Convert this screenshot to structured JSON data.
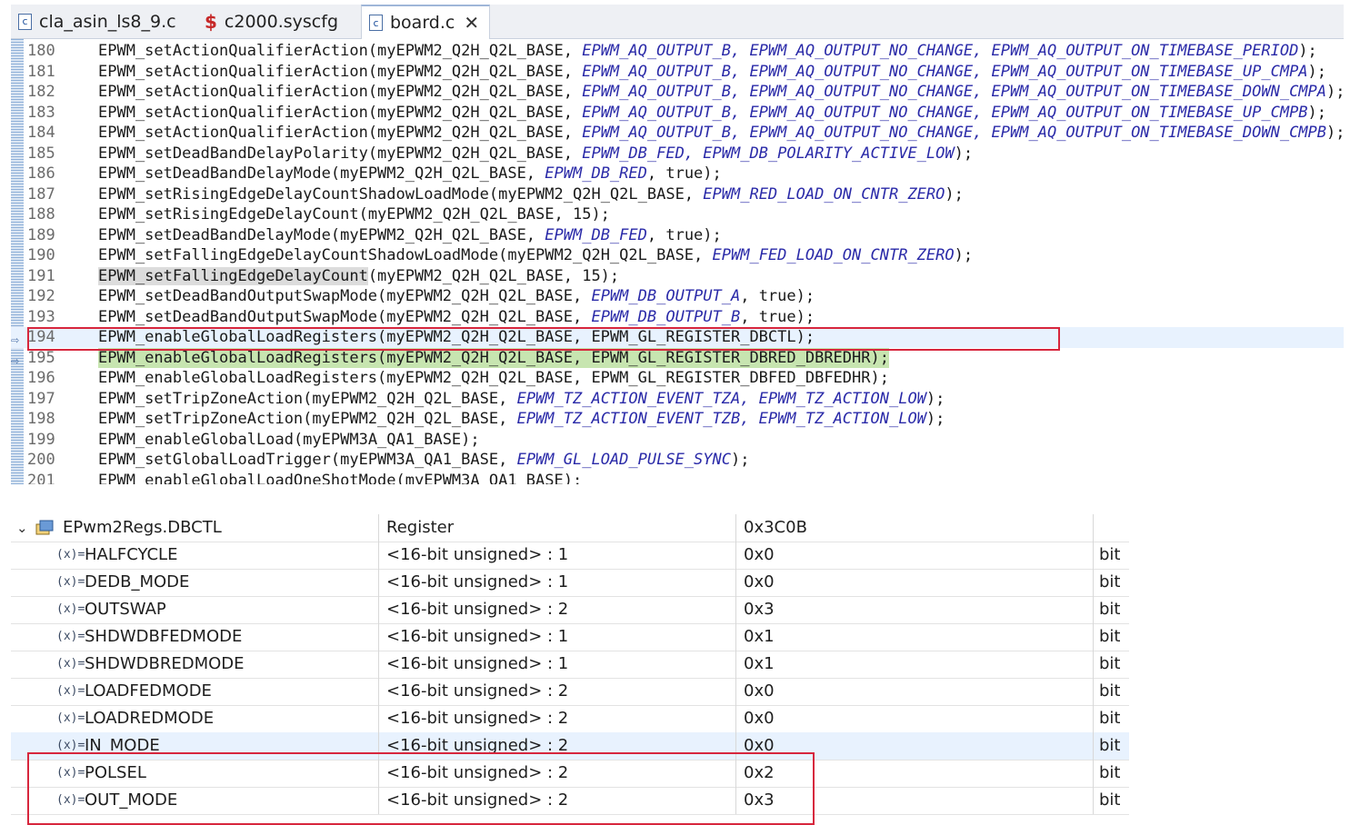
{
  "tabs": [
    {
      "label": "cla_asin_ls8_9.c",
      "icon": "c-file-icon"
    },
    {
      "label": "c2000.syscfg",
      "icon": "syscfg-icon"
    },
    {
      "label": "board.c",
      "icon": "c-file-icon",
      "active": true
    }
  ],
  "editor": {
    "lines": [
      {
        "num": "180",
        "fn": "EPWM_setActionQualifierAction",
        "args": "(myEPWM2_Q2H_Q2L_BASE, ",
        "consts": "EPWM_AQ_OUTPUT_B, EPWM_AQ_OUTPUT_NO_CHANGE, EPWM_AQ_OUTPUT_ON_TIMEBASE_PERIOD",
        "tail": ");"
      },
      {
        "num": "181",
        "fn": "EPWM_setActionQualifierAction",
        "args": "(myEPWM2_Q2H_Q2L_BASE, ",
        "consts": "EPWM_AQ_OUTPUT_B, EPWM_AQ_OUTPUT_NO_CHANGE, EPWM_AQ_OUTPUT_ON_TIMEBASE_UP_CMPA",
        "tail": ");"
      },
      {
        "num": "182",
        "fn": "EPWM_setActionQualifierAction",
        "args": "(myEPWM2_Q2H_Q2L_BASE, ",
        "consts": "EPWM_AQ_OUTPUT_B, EPWM_AQ_OUTPUT_NO_CHANGE, EPWM_AQ_OUTPUT_ON_TIMEBASE_DOWN_CMPA",
        "tail": ");"
      },
      {
        "num": "183",
        "fn": "EPWM_setActionQualifierAction",
        "args": "(myEPWM2_Q2H_Q2L_BASE, ",
        "consts": "EPWM_AQ_OUTPUT_B, EPWM_AQ_OUTPUT_NO_CHANGE, EPWM_AQ_OUTPUT_ON_TIMEBASE_UP_CMPB",
        "tail": ");"
      },
      {
        "num": "184",
        "fn": "EPWM_setActionQualifierAction",
        "args": "(myEPWM2_Q2H_Q2L_BASE, ",
        "consts": "EPWM_AQ_OUTPUT_B, EPWM_AQ_OUTPUT_NO_CHANGE, EPWM_AQ_OUTPUT_ON_TIMEBASE_DOWN_CMPB",
        "tail": ");"
      },
      {
        "num": "185",
        "fn": "EPWM_setDeadBandDelayPolarity",
        "args": "(myEPWM2_Q2H_Q2L_BASE, ",
        "consts": "EPWM_DB_FED, EPWM_DB_POLARITY_ACTIVE_LOW",
        "tail": ");"
      },
      {
        "num": "186",
        "fn": "EPWM_setDeadBandDelayMode",
        "args": "(myEPWM2_Q2H_Q2L_BASE, ",
        "consts": "EPWM_DB_RED",
        "tail": ", true);"
      },
      {
        "num": "187",
        "fn": "EPWM_setRisingEdgeDelayCountShadowLoadMode",
        "args": "(myEPWM2_Q2H_Q2L_BASE, ",
        "consts": "EPWM_RED_LOAD_ON_CNTR_ZERO",
        "tail": ");"
      },
      {
        "num": "188",
        "fn": "EPWM_setRisingEdgeDelayCount",
        "args": "(myEPWM2_Q2H_Q2L_BASE, 15);",
        "consts": "",
        "tail": ""
      },
      {
        "num": "189",
        "fn": "EPWM_setDeadBandDelayMode",
        "args": "(myEPWM2_Q2H_Q2L_BASE, ",
        "consts": "EPWM_DB_FED",
        "tail": ", true);"
      },
      {
        "num": "190",
        "fn": "EPWM_setFallingEdgeDelayCountShadowLoadMode",
        "args": "(myEPWM2_Q2H_Q2L_BASE, ",
        "consts": "EPWM_FED_LOAD_ON_CNTR_ZERO",
        "tail": ");"
      },
      {
        "num": "191",
        "fn": "EPWM_setFallingEdgeDelayCount",
        "args": "(myEPWM2_Q2H_Q2L_BASE, 15);",
        "consts": "",
        "tail": "",
        "fn_highlight": true
      },
      {
        "num": "192",
        "fn": "EPWM_setDeadBandOutputSwapMode",
        "args": "(myEPWM2_Q2H_Q2L_BASE, ",
        "consts": "EPWM_DB_OUTPUT_A",
        "tail": ", true);"
      },
      {
        "num": "193",
        "fn": "EPWM_setDeadBandOutputSwapMode",
        "args": "(myEPWM2_Q2H_Q2L_BASE, ",
        "consts": "EPWM_DB_OUTPUT_B",
        "tail": ", true);"
      },
      {
        "num": "194",
        "fn": "EPWM_enableGlobalLoadRegisters",
        "args": "(myEPWM2_Q2H_Q2L_BASE, EPWM_GL_REGISTER_DBCTL);",
        "consts": "",
        "tail": "",
        "current": true,
        "marker": true
      },
      {
        "num": "195",
        "fn": "EPWM_enableGlobalLoadRegisters",
        "args": "(myEPWM2_Q2H_Q2L_BASE, EPWM_GL_REGISTER_DBRED_DBREDHR);",
        "consts": "",
        "tail": "",
        "green": true,
        "marker": true
      },
      {
        "num": "196",
        "fn": "EPWM_enableGlobalLoadRegisters",
        "args": "(myEPWM2_Q2H_Q2L_BASE, EPWM_GL_REGISTER_DBFED_DBFEDHR);",
        "consts": "",
        "tail": ""
      },
      {
        "num": "197",
        "fn": "EPWM_setTripZoneAction",
        "args": "(myEPWM2_Q2H_Q2L_BASE, ",
        "consts": "EPWM_TZ_ACTION_EVENT_TZA, EPWM_TZ_ACTION_LOW",
        "tail": ");"
      },
      {
        "num": "198",
        "fn": "EPWM_setTripZoneAction",
        "args": "(myEPWM2_Q2H_Q2L_BASE, ",
        "consts": "EPWM_TZ_ACTION_EVENT_TZB, EPWM_TZ_ACTION_LOW",
        "tail": ");"
      },
      {
        "num": "199",
        "fn": "EPWM_enableGlobalLoad",
        "args": "(myEPWM3A_QA1_BASE);",
        "consts": "",
        "tail": ""
      },
      {
        "num": "200",
        "fn": "EPWM_setGlobalLoadTrigger",
        "args": "(myEPWM3A_QA1_BASE, ",
        "consts": "EPWM_GL_LOAD_PULSE_SYNC",
        "tail": ");"
      },
      {
        "num": "201",
        "fn": "EPWM_enableGlobalLoadOneShotMode",
        "args": "(myEPWM3A_QA1_BASE);",
        "consts": "",
        "tail": ""
      }
    ]
  },
  "variables": {
    "header": {
      "name": "EPwm2Regs.DBCTL",
      "type": "Register",
      "value": "0x3C0B"
    },
    "rows": [
      {
        "name": "HALFCYCLE",
        "type": "<16-bit unsigned> : 1",
        "value": "0x0",
        "fmt": "bit"
      },
      {
        "name": "DEDB_MODE",
        "type": "<16-bit unsigned> : 1",
        "value": "0x0",
        "fmt": "bit"
      },
      {
        "name": "OUTSWAP",
        "type": "<16-bit unsigned> : 2",
        "value": "0x3",
        "fmt": "bit"
      },
      {
        "name": "SHDWDBFEDMODE",
        "type": "<16-bit unsigned> : 1",
        "value": "0x1",
        "fmt": "bit"
      },
      {
        "name": "SHDWDBREDMODE",
        "type": "<16-bit unsigned> : 1",
        "value": "0x1",
        "fmt": "bit"
      },
      {
        "name": "LOADFEDMODE",
        "type": "<16-bit unsigned> : 2",
        "value": "0x0",
        "fmt": "bit"
      },
      {
        "name": "LOADREDMODE",
        "type": "<16-bit unsigned> : 2",
        "value": "0x0",
        "fmt": "bit"
      },
      {
        "name": "IN_MODE",
        "type": "<16-bit unsigned> : 2",
        "value": "0x0",
        "fmt": "bit",
        "selected": true
      },
      {
        "name": "POLSEL",
        "type": "<16-bit unsigned> : 2",
        "value": "0x2",
        "fmt": "bit"
      },
      {
        "name": "OUT_MODE",
        "type": "<16-bit unsigned> : 2",
        "value": "0x3",
        "fmt": "bit"
      }
    ],
    "var_icon_text": "(x)="
  },
  "colors": {
    "annotation_box": "#d7263d",
    "constant_text": "#2a2aa8",
    "current_line": "#e8f2fe",
    "debug_line": "#c7e5b0"
  }
}
